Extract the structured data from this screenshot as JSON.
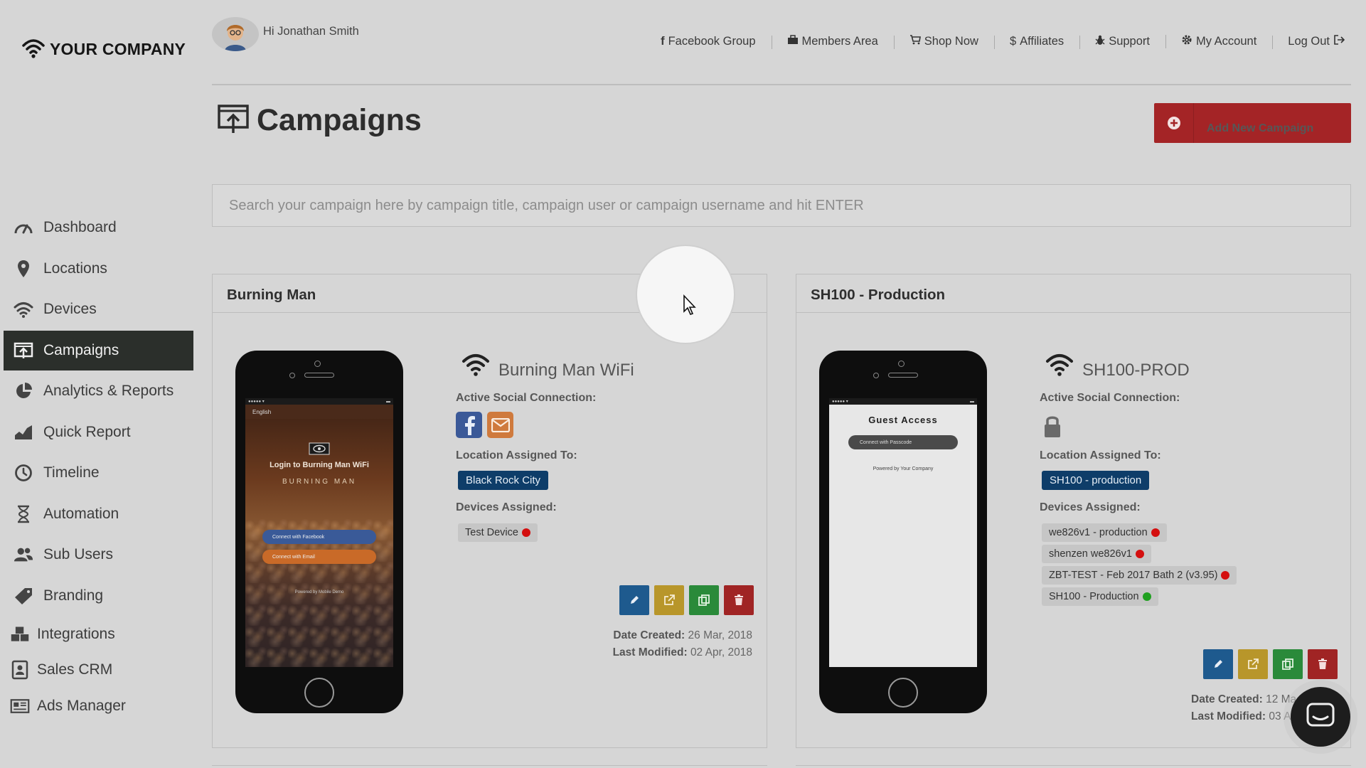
{
  "brand": {
    "name": "YOUR COMPANY"
  },
  "header": {
    "greeting": "Hi Jonathan Smith",
    "links": [
      {
        "label": "Facebook Group",
        "icon": "facebook-icon"
      },
      {
        "label": "Members Area",
        "icon": "briefcase-icon"
      },
      {
        "label": "Shop Now",
        "icon": "cart-icon"
      },
      {
        "label": "Affiliates",
        "icon": "dollar-icon"
      },
      {
        "label": "Support",
        "icon": "bug-icon"
      },
      {
        "label": "My Account",
        "icon": "gear-icon"
      },
      {
        "label": "Log Out",
        "icon": "logout-icon"
      }
    ]
  },
  "sidebar": {
    "items": [
      {
        "label": "Dashboard",
        "icon": "speedometer-icon"
      },
      {
        "label": "Locations",
        "icon": "map-pin-icon"
      },
      {
        "label": "Devices",
        "icon": "wifi-icon"
      },
      {
        "label": "Campaigns",
        "icon": "campaign-icon",
        "active": true
      },
      {
        "label": "Analytics & Reports",
        "icon": "pie-chart-icon"
      },
      {
        "label": "Quick Report",
        "icon": "area-chart-icon"
      },
      {
        "label": "Timeline",
        "icon": "clock-icon"
      },
      {
        "label": "Automation",
        "icon": "hourglass-icon"
      },
      {
        "label": "Sub Users",
        "icon": "users-icon"
      },
      {
        "label": "Branding",
        "icon": "tag-icon"
      },
      {
        "label": "Integrations",
        "icon": "cubes-icon"
      },
      {
        "label": "Sales CRM",
        "icon": "address-book-icon"
      },
      {
        "label": "Ads Manager",
        "icon": "newspaper-icon"
      }
    ]
  },
  "page": {
    "title": "Campaigns",
    "add_button": "Add New Campaign",
    "search_placeholder": "Search your campaign here by campaign title, campaign user or campaign username and hit ENTER"
  },
  "campaigns": [
    {
      "title": "Burning Man",
      "ssid": "Burning Man WiFi",
      "social_label": "Active Social Connection:",
      "social": [
        "facebook-icon",
        "email-icon"
      ],
      "location_label": "Location Assigned To:",
      "location": "Black Rock City",
      "devices_label": "Devices Assigned:",
      "devices": [
        {
          "name": "Test Device",
          "status": "red"
        }
      ],
      "preview": {
        "language": "English",
        "login_title": "Login to Burning Man WiFi",
        "event_logo": "BURNING MAN",
        "facebook_button": "Connect with Facebook",
        "email_button": "Connect with Email",
        "powered": "Powered by Mobile Demo"
      },
      "date_created_label": "Date Created:",
      "date_created": "26 Mar, 2018",
      "last_modified_label": "Last Modified:",
      "last_modified": "02 Apr, 2018"
    },
    {
      "title": "SH100 - Production",
      "ssid": "SH100-PROD",
      "social_label": "Active Social Connection:",
      "social": [
        "lock-icon"
      ],
      "location_label": "Location Assigned To:",
      "location": "SH100 - production",
      "devices_label": "Devices Assigned:",
      "devices": [
        {
          "name": "we826v1 - production",
          "status": "red"
        },
        {
          "name": "shenzen we826v1",
          "status": "red"
        },
        {
          "name": "ZBT-TEST - Feb 2017 Bath 2 (v3.95)",
          "status": "red"
        },
        {
          "name": "SH100 - Production",
          "status": "green"
        }
      ],
      "preview": {
        "guest_title": "Guest Access",
        "passcode_button": "Connect with Passcode",
        "powered": "Powered by Your Company"
      },
      "date_created_label": "Date Created:",
      "date_created": "12 Ma",
      "last_modified_label": "Last Modified:",
      "last_modified": "03 A"
    }
  ],
  "colors": {
    "active_nav": "#2b2f2b",
    "add_button": "#a42426",
    "location_badge": "#0e3d69",
    "edit": "#1e5a8e",
    "open": "#b8962a",
    "copy": "#2a8a3a",
    "delete": "#a02424"
  }
}
